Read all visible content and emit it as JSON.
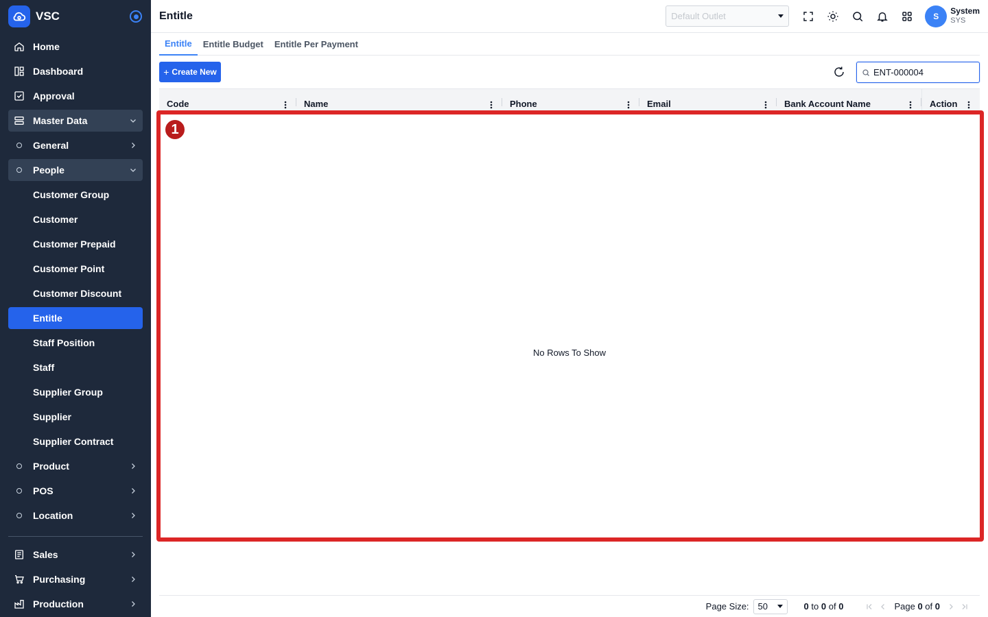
{
  "app": {
    "name": "VSC"
  },
  "sidebar": {
    "top_items": [
      {
        "label": "Home",
        "icon": "home-icon"
      },
      {
        "label": "Dashboard",
        "icon": "dashboard-icon"
      },
      {
        "label": "Approval",
        "icon": "approval-icon"
      }
    ],
    "master_data": {
      "label": "Master Data",
      "general": "General",
      "people": {
        "label": "People",
        "items": [
          "Customer Group",
          "Customer",
          "Customer Prepaid",
          "Customer Point",
          "Customer Discount",
          "Entitle",
          "Staff Position",
          "Staff",
          "Supplier Group",
          "Supplier",
          "Supplier Contract"
        ],
        "active_item": "Entitle"
      },
      "product": "Product",
      "pos": "POS",
      "location": "Location"
    },
    "bottom_items": [
      {
        "label": "Sales",
        "icon": "sales-icon"
      },
      {
        "label": "Purchasing",
        "icon": "cart-icon"
      },
      {
        "label": "Production",
        "icon": "production-icon"
      }
    ]
  },
  "header": {
    "title": "Entitle",
    "outlet_placeholder": "Default Outlet",
    "user": {
      "initial": "S",
      "name": "System",
      "code": "SYS"
    }
  },
  "tabs": [
    {
      "label": "Entitle",
      "active": true
    },
    {
      "label": "Entitle Budget",
      "active": false
    },
    {
      "label": "Entitle Per Payment",
      "active": false
    }
  ],
  "toolbar": {
    "create_label": "Create New",
    "search_value": "ENT-000004"
  },
  "grid": {
    "columns": [
      "Code",
      "Name",
      "Phone",
      "Email",
      "Bank Account Name",
      "Action"
    ],
    "empty_text": "No Rows To Show"
  },
  "annotation": {
    "number": "1",
    "color": "#dc2626"
  },
  "pagination": {
    "page_size_label": "Page Size:",
    "page_size": "50",
    "range_from": "0",
    "range_to_word": "to",
    "range_to": "0",
    "range_of_word": "of",
    "range_total": "0",
    "page_word": "Page",
    "page_current": "0",
    "page_of_word": "of",
    "page_total": "0"
  },
  "colors": {
    "sidebar": "#1e293b",
    "accent": "#2563eb",
    "highlight": "#dc2626"
  }
}
